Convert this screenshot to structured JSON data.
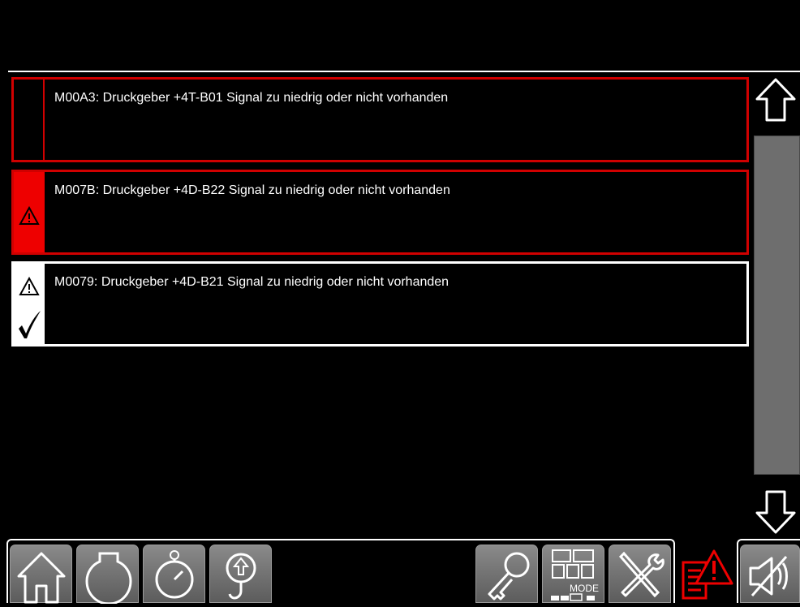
{
  "alarms": [
    {
      "text": "M00A3: Druckgeber +4T-B01 Signal zu niedrig oder nicht vorhanden",
      "state": "inactive"
    },
    {
      "text": "M007B: Druckgeber +4D-B22 Signal zu niedrig oder nicht vorhanden",
      "state": "active"
    },
    {
      "text": "M0079: Druckgeber +4D-B21 Signal zu niedrig oder nicht vorhanden",
      "state": "acknowledged"
    }
  ],
  "toolbar": {
    "mode_label": "MODE",
    "buttons": [
      "home-icon",
      "engine-icon",
      "stopwatch-icon",
      "crane-hook-icon",
      "key-icon",
      "mode-icon",
      "tools-icon",
      "alarm-list-icon",
      "mute-horn-icon"
    ]
  },
  "colors": {
    "alarm_red": "#ee0000",
    "button_grey": "#7a7a7a",
    "scroll_track": "#6e6e6e"
  }
}
